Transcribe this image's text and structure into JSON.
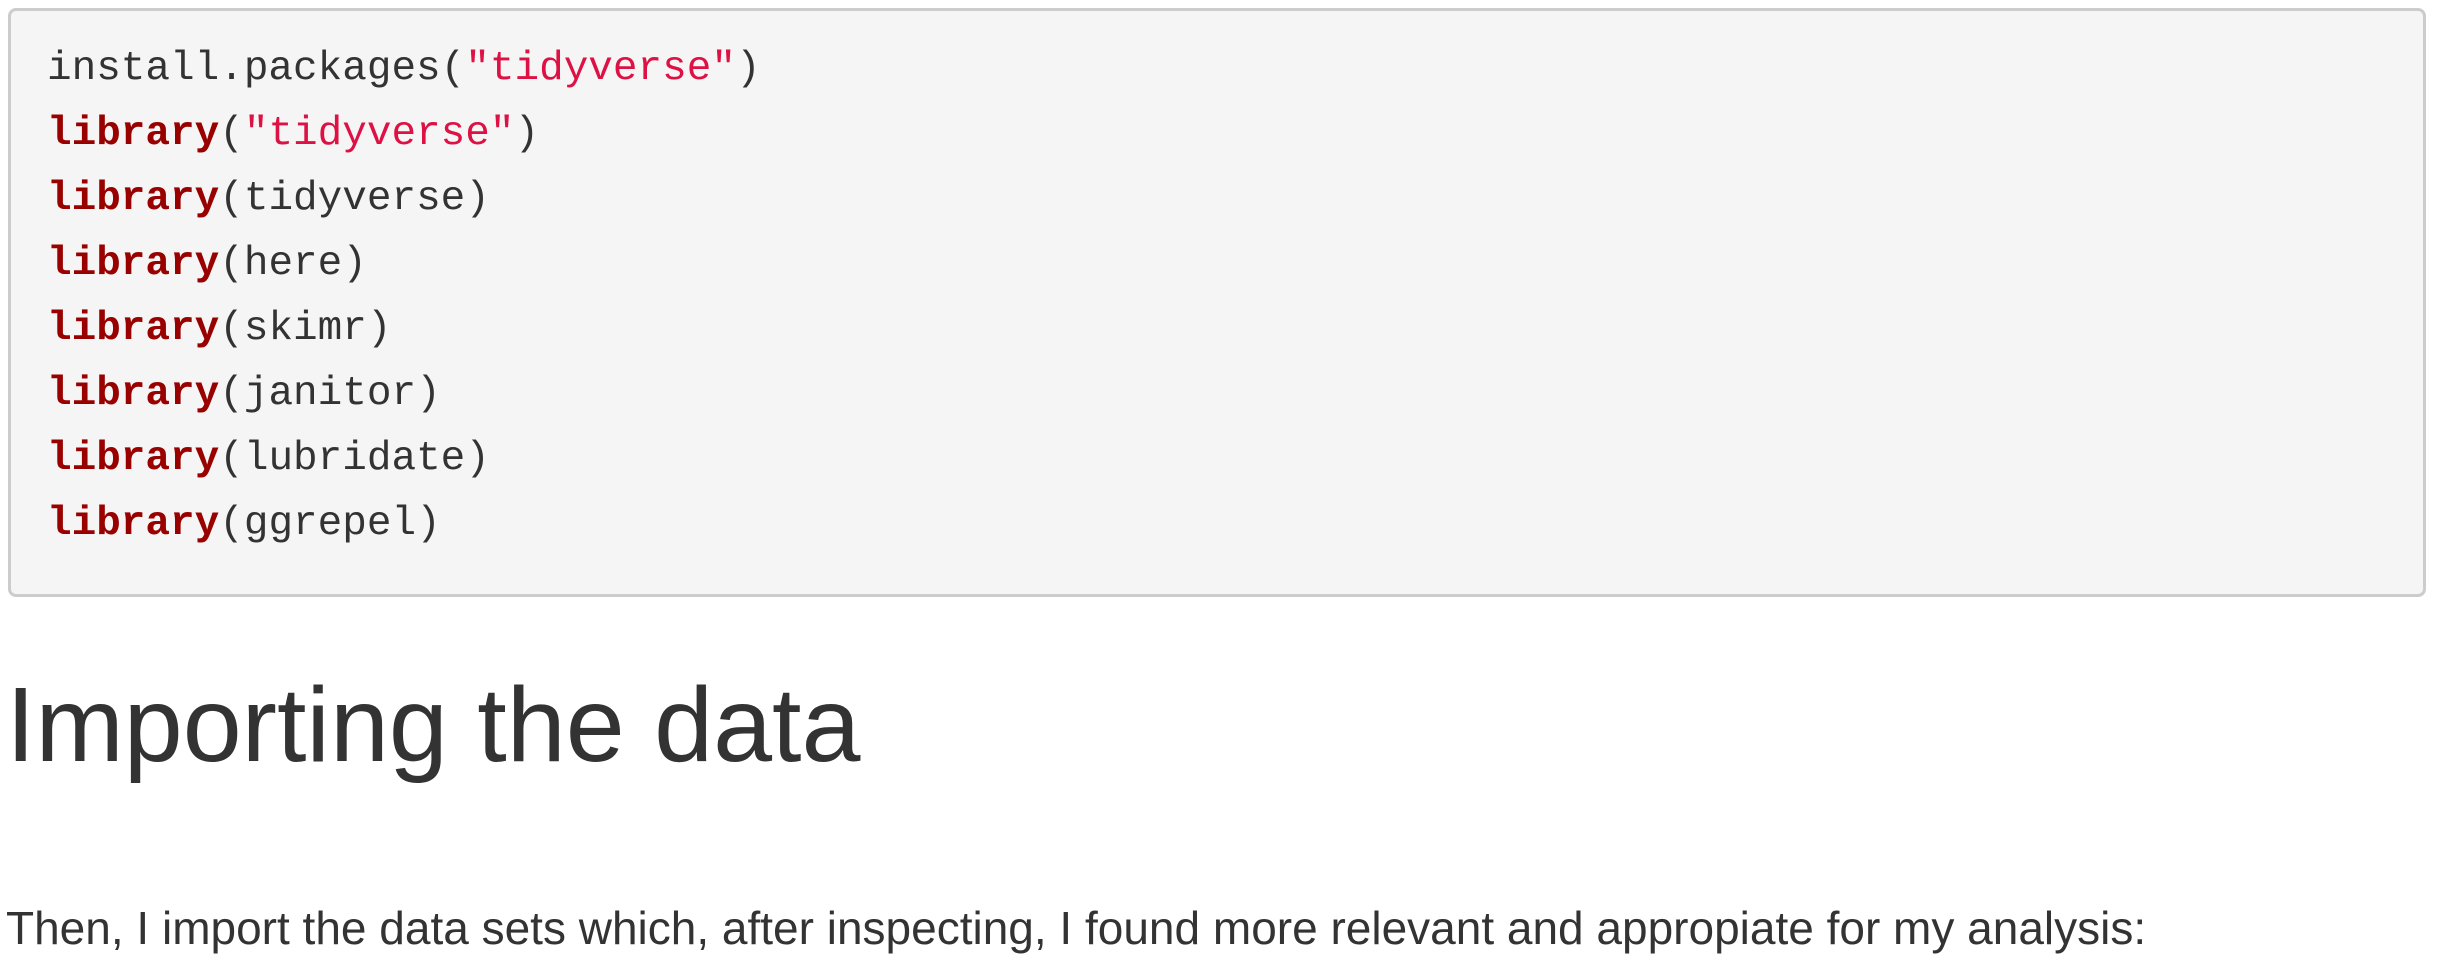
{
  "code": {
    "lines": [
      {
        "fn": "install.packages",
        "open": "(",
        "arg": "\"tidyverse\"",
        "close": ")"
      },
      {
        "kw": "library",
        "open": "(",
        "arg": "\"tidyverse\"",
        "close": ")"
      },
      {
        "kw": "library",
        "open": "(",
        "arg": "tidyverse",
        "close": ")"
      },
      {
        "kw": "library",
        "open": "(",
        "arg": "here",
        "close": ")"
      },
      {
        "kw": "library",
        "open": "(",
        "arg": "skimr",
        "close": ")"
      },
      {
        "kw": "library",
        "open": "(",
        "arg": "janitor",
        "close": ")"
      },
      {
        "kw": "library",
        "open": "(",
        "arg": "lubridate",
        "close": ")"
      },
      {
        "kw": "library",
        "open": "(",
        "arg": "ggrepel",
        "close": ")"
      }
    ]
  },
  "section": {
    "heading": "Importing the data",
    "paragraph": "Then, I import the data sets which, after inspecting, I found more relevant and appropiate for my analysis:"
  },
  "colors": {
    "keyword": "#990000",
    "string": "#dd1144",
    "code_background": "#f5f5f5",
    "code_border": "#cccccc",
    "text": "#333333"
  }
}
